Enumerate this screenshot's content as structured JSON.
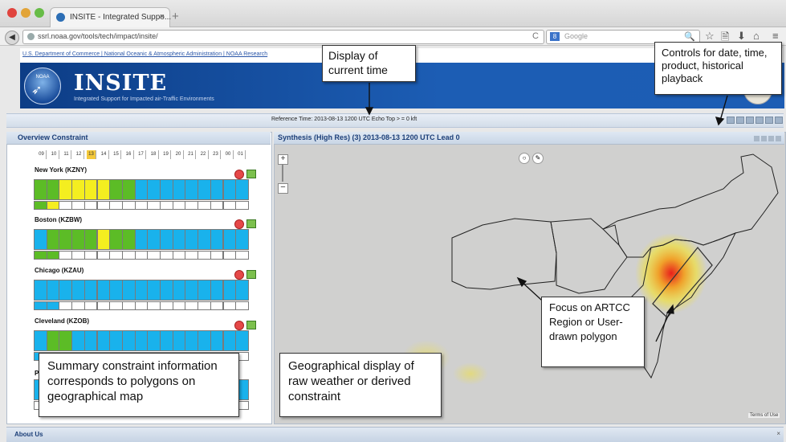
{
  "browser": {
    "tab_title": "INSITE - Integrated Suppo...",
    "tab_close": "×",
    "new_tab": "+",
    "url": "ssrl.noaa.gov/tools/tech/impact/insite/",
    "reload": "C",
    "search_placeholder": "Google",
    "search_engine": "8",
    "search_glass": "🔍",
    "back": "◀",
    "toolbar_icons": [
      "☆",
      "🗎",
      "⬇",
      "⌂",
      "≡"
    ]
  },
  "header": {
    "doc_links": "U.S. Department of Commerce | National Oceanic & Atmospheric Administration | NOAA Research",
    "logo_text": "NOAA",
    "app_title": "INSITE",
    "app_subtitle": "Integrated Support for Impacted air-Traffic Environments",
    "reference_time": "Reference Time: 2013-08-13 1200 UTC  Echo Top > = 0 kft"
  },
  "left_panel": {
    "title": "Overview Constraint",
    "hours": [
      "09",
      "10",
      "11",
      "12",
      "13",
      "14",
      "15",
      "16",
      "17",
      "18",
      "19",
      "20",
      "21",
      "22",
      "23",
      "00",
      "01"
    ],
    "selected_hour": "13",
    "regions": [
      {
        "label": "New York (KZNY)",
        "top": [
          "g",
          "g",
          "y",
          "y",
          "y",
          "y",
          "g",
          "g",
          "b",
          "b",
          "b",
          "b",
          "b",
          "b",
          "b",
          "b",
          "b"
        ],
        "bottom": [
          "g",
          "y",
          "w",
          "w",
          "w",
          "w",
          "w",
          "w",
          "w",
          "w",
          "w",
          "w",
          "w",
          "w",
          "w",
          "w",
          "w"
        ]
      },
      {
        "label": "Boston (KZBW)",
        "top": [
          "b",
          "g",
          "g",
          "g",
          "g",
          "y",
          "g",
          "g",
          "b",
          "b",
          "b",
          "b",
          "b",
          "b",
          "b",
          "b",
          "b"
        ],
        "bottom": [
          "g",
          "g",
          "w",
          "w",
          "w",
          "w",
          "w",
          "w",
          "w",
          "w",
          "w",
          "w",
          "w",
          "w",
          "w",
          "w",
          "w"
        ]
      },
      {
        "label": "Chicago (KZAU)",
        "top": [
          "b",
          "b",
          "b",
          "b",
          "b",
          "b",
          "b",
          "b",
          "b",
          "b",
          "b",
          "b",
          "b",
          "b",
          "b",
          "b",
          "b"
        ],
        "bottom": [
          "b",
          "b",
          "w",
          "w",
          "w",
          "w",
          "w",
          "w",
          "w",
          "w",
          "w",
          "w",
          "w",
          "w",
          "w",
          "w",
          "w"
        ]
      },
      {
        "label": "Cleveland (KZOB)",
        "top": [
          "b",
          "g",
          "g",
          "b",
          "b",
          "b",
          "b",
          "b",
          "b",
          "b",
          "b",
          "b",
          "b",
          "b",
          "b",
          "b",
          "b"
        ],
        "bottom": [
          "b",
          "b",
          "w",
          "w",
          "w",
          "w",
          "w",
          "w",
          "w",
          "w",
          "w",
          "w",
          "w",
          "w",
          "w",
          "w",
          "w"
        ]
      }
    ],
    "partial_region_initial": "P"
  },
  "map": {
    "title": "Synthesis (High Res) (3) 2013-08-13 1200 UTC Lead 0",
    "zoom_in": "+",
    "zoom_out": "−",
    "tools": [
      "○",
      "✎"
    ],
    "terms": "Terms of Use"
  },
  "annotations": {
    "time": "Display of current time",
    "controls": "Controls for date, time, product, historical playback",
    "summary": "Summary constraint information corresponds to polygons on geographical map",
    "geo": "Geographical display of raw weather or derived constraint",
    "focus": "Focus on ARTCC Region or User-drawn polygon"
  },
  "footer": {
    "about": "About Us",
    "close": "×"
  },
  "colors": {
    "blue": "#19b2ec",
    "green": "#5cbc26",
    "yellow": "#f4ee20",
    "white": "#ffffff",
    "banner": "#1c5db4"
  }
}
